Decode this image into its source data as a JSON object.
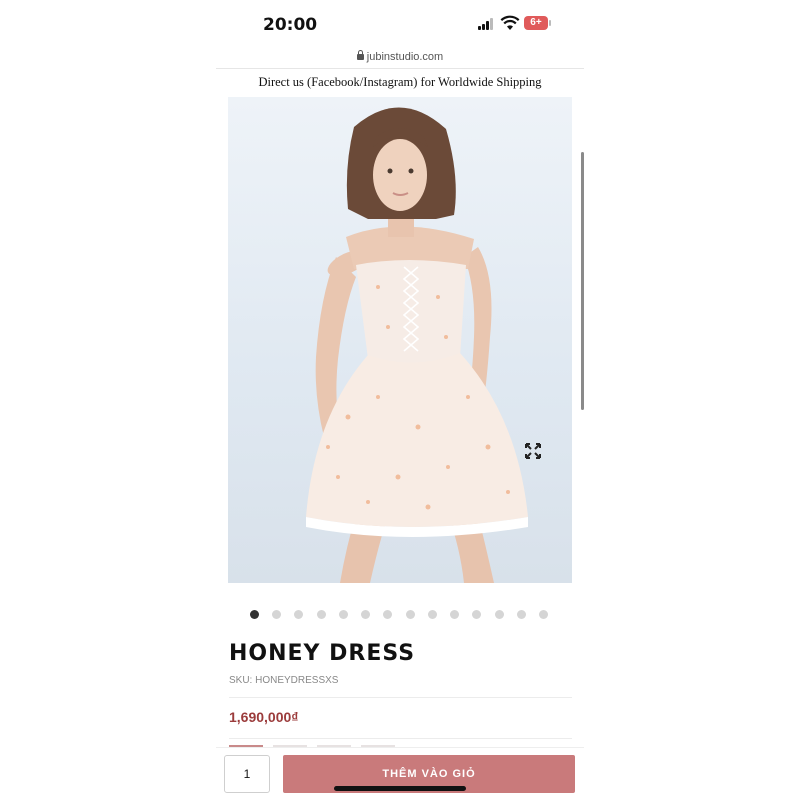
{
  "status_bar": {
    "time": "20:00",
    "battery": "6+"
  },
  "browser": {
    "url": "jubinstudio.com"
  },
  "banner": {
    "text": "Direct us (Facebook/Instagram) for Worldwide Shipping"
  },
  "product": {
    "image_alt_icon": "dress-photo",
    "title": "HONEY DRESS",
    "sku": "SKU: HONEYDRESSXS",
    "price": "1,690,000₫",
    "gallery": {
      "total_images": 14,
      "active_index": 0
    }
  },
  "cart": {
    "quantity": "1",
    "add_label": "THÊM VÀO GIỎ"
  },
  "colors": {
    "price": "#9b3b3b",
    "add_button": "#c97a7b"
  }
}
